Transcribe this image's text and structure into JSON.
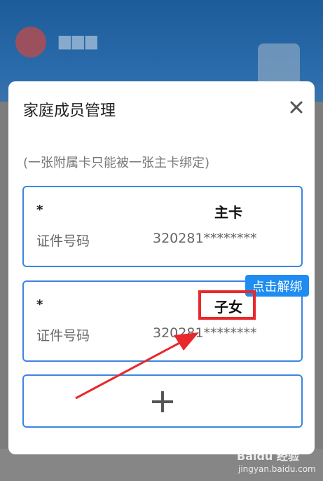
{
  "modal": {
    "title": "家庭成员管理",
    "hint": "(一张附属卡只能被一张主卡绑定)"
  },
  "members": [
    {
      "name": "*",
      "role": "主卡",
      "id_label": "证件号码",
      "id_value": "320281********"
    },
    {
      "name": "*",
      "role": "子女",
      "id_label": "证件号码",
      "id_value": "320281********",
      "action_label": "点击解绑"
    }
  ],
  "add_button": {
    "symbol": "+"
  },
  "watermark": {
    "brand": "Baidu 经验",
    "url": "jingyan.baidu.com"
  },
  "colors": {
    "accent": "#3a86e0",
    "unbind_button": "#1e8cf0",
    "highlight": "#e8282a"
  }
}
